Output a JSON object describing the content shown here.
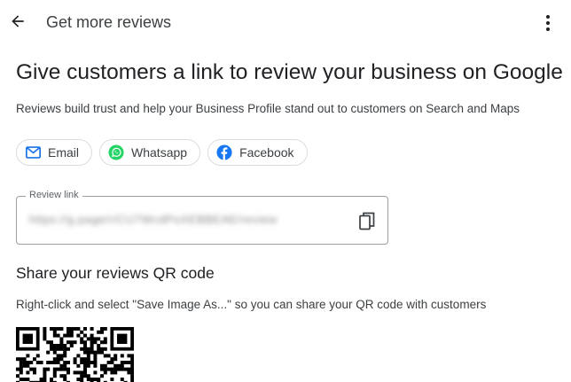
{
  "header": {
    "title": "Get more reviews",
    "back_icon": "arrow-left-icon",
    "more_icon": "more-vert-icon"
  },
  "main": {
    "title": "Give customers a link to review your business on Google",
    "subtitle": "Reviews build trust and help your Business Profile stand out to customers on Search and Maps"
  },
  "share": {
    "email_label": "Email",
    "whatsapp_label": "Whatsapp",
    "facebook_label": "Facebook"
  },
  "review_link": {
    "label": "Review link",
    "value": "https://g.page/r/CU7WcdPoXEBBEAE/review"
  },
  "qr": {
    "heading": "Share your reviews QR code",
    "description": "Right-click and select \"Save Image As...\" so you can share your QR code with customers"
  },
  "colors": {
    "accent_blue": "#1a73e8",
    "whatsapp_green": "#25d366",
    "facebook_blue": "#1877f2",
    "text_primary": "#202124",
    "text_secondary": "#3c4043"
  }
}
